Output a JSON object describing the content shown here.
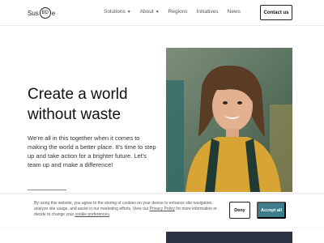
{
  "header": {
    "logo_left": "Sus",
    "logo_ring": "BD",
    "logo_right": "e",
    "nav": [
      {
        "label": "Solutions",
        "has_dropdown": true
      },
      {
        "label": "About",
        "has_dropdown": true
      },
      {
        "label": "Regions",
        "has_dropdown": false
      },
      {
        "label": "Initiatives",
        "has_dropdown": false
      },
      {
        "label": "News",
        "has_dropdown": false
      }
    ],
    "contact_label": "Contact us"
  },
  "hero": {
    "title_line1": "Create a world",
    "title_line2": "without waste",
    "body": "We're all in this together when it comes to making the world a better place. It's time to step up and take action for a brighter future. Let's team up and make a difference!"
  },
  "cookie": {
    "text_part1": "By using this website, you agree to the storing of cookies on your device to enhance site navigation, analyze site usage, and assist in our marketing efforts. View our ",
    "privacy_link": "Privacy Policy",
    "text_part2": " for more information or decide to change your ",
    "prefs_link": "cookie preferences",
    "text_part3": ".",
    "deny_label": "Deny",
    "accept_label": "Accept all"
  },
  "colors": {
    "accent": "#3d7d8c",
    "photo_bg": "#5f7a69"
  }
}
